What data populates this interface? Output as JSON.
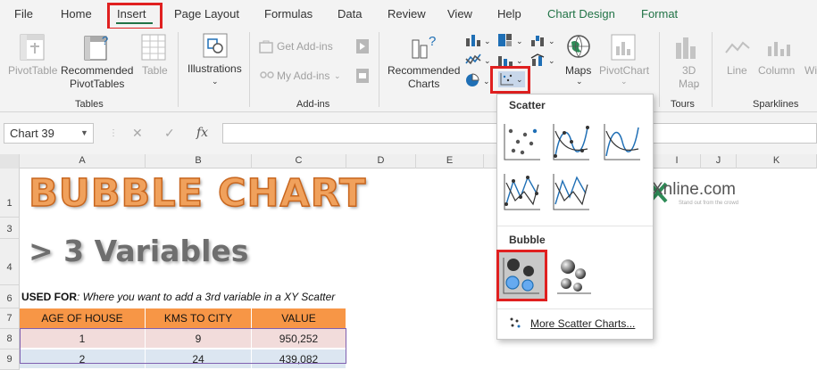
{
  "tabs": [
    "File",
    "Home",
    "Insert",
    "Page Layout",
    "Formulas",
    "Data",
    "Review",
    "View",
    "Help",
    "Chart Design",
    "Format"
  ],
  "ribbon": {
    "tables": {
      "pivottable": "PivotTable",
      "recommended_pivottables": [
        "Recommended",
        "PivotTables"
      ],
      "table": "Table",
      "group": "Tables"
    },
    "illustrations": {
      "label": "Illustrations"
    },
    "addins": {
      "get": "Get Add-ins",
      "my": "My Add-ins",
      "group": "Add-ins"
    },
    "charts": {
      "recommended": [
        "Recommended",
        "Charts"
      ],
      "maps": "Maps",
      "pivotchart": "PivotChart"
    },
    "tours": {
      "map3d": [
        "3D",
        "Map"
      ],
      "group": "Tours"
    },
    "sparklines": {
      "line": "Line",
      "column": "Column",
      "winloss": "Wi",
      "group": "Sparklines"
    }
  },
  "formula_bar": {
    "name_box": "Chart 39",
    "fx": "fx",
    "value": ""
  },
  "columns": [
    "A",
    "B",
    "C",
    "D",
    "E",
    "I",
    "J",
    "K"
  ],
  "rows": [
    "1",
    "3",
    "4",
    "6",
    "7",
    "8",
    "9"
  ],
  "sheet": {
    "title": "BUBBLE CHART",
    "subtitle": "> 3 Variables",
    "used_for_label": "USED FOR",
    "used_for_text": ": Where you want to add a 3rd variable in a XY Scatter",
    "logo": "Xnline.com",
    "logo_tag": "Stand out from the crowd",
    "headers": [
      "AGE OF HOUSE",
      "KMS TO CITY",
      "VALUE"
    ],
    "data_rows": [
      [
        "1",
        "9",
        "950,252"
      ],
      [
        "2",
        "24",
        "439,082"
      ]
    ]
  },
  "dropdown": {
    "scatter_heading": "Scatter",
    "bubble_heading": "Bubble",
    "more": "More Scatter Charts..."
  },
  "colors": {
    "excel_green": "#217346",
    "highlight_red": "#e02020",
    "header_orange": "#f79646",
    "row_pink": "#f2dcdb",
    "row_blue": "#dce6f1"
  }
}
